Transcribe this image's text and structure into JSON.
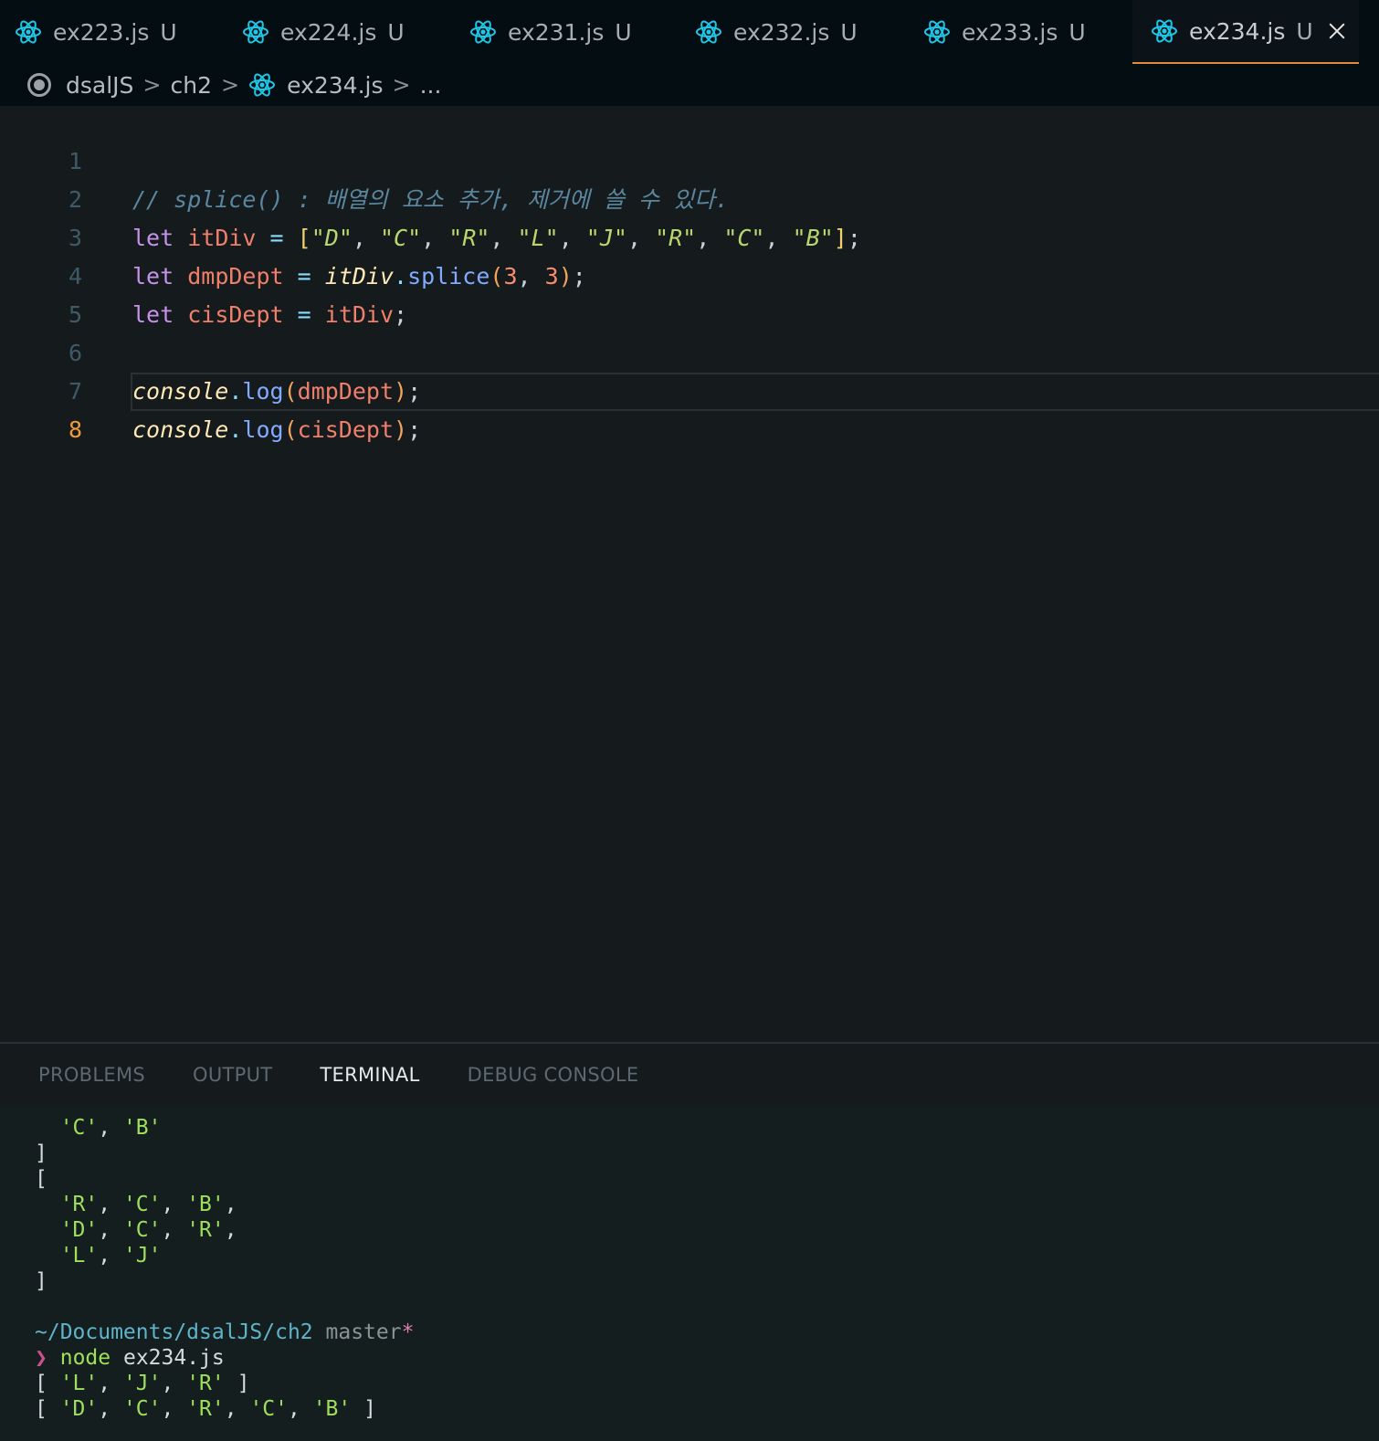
{
  "tabs": [
    {
      "label": "ex223.js",
      "status": "U"
    },
    {
      "label": "ex224.js",
      "status": "U"
    },
    {
      "label": "ex231.js",
      "status": "U"
    },
    {
      "label": "ex232.js",
      "status": "U"
    },
    {
      "label": "ex233.js",
      "status": "U"
    },
    {
      "label": "ex234.js",
      "status": "U",
      "active": true
    }
  ],
  "breadcrumb": {
    "root": "dsalJS",
    "folder": "ch2",
    "file": "ex234.js",
    "more": "...",
    "separator": ">"
  },
  "editor": {
    "current_line": 8,
    "line_numbers": [
      "1",
      "2",
      "3",
      "4",
      "5",
      "6",
      "7",
      "8"
    ],
    "lines": {
      "l1": {
        "comment": "// splice() : 배열의 요소 추가, 제거에 쓸 수 있다."
      },
      "l2": {
        "kw": "let",
        "var": "itDiv",
        "op": "=",
        "open": "[",
        "items": [
          "\"D\"",
          "\"C\"",
          "\"R\"",
          "\"L\"",
          "\"J\"",
          "\"R\"",
          "\"C\"",
          "\"B\""
        ],
        "close": "]",
        "end": ";"
      },
      "l3": {
        "kw": "let",
        "var": "dmpDept",
        "op": "=",
        "obj": "itDiv",
        "dot": ".",
        "fn": "splice",
        "lp": "(",
        "a1": "3",
        "comma": ",",
        "a2": "3",
        "rp": ")",
        "end": ";"
      },
      "l4": {
        "kw": "let",
        "var": "cisDept",
        "op": "=",
        "val": "itDiv",
        "end": ";"
      },
      "l6": {
        "obj": "console",
        "dot": ".",
        "fn": "log",
        "lp": "(",
        "arg": "dmpDept",
        "rp": ")",
        "end": ";"
      },
      "l7": {
        "obj": "console",
        "dot": ".",
        "fn": "log",
        "lp": "(",
        "arg": "cisDept",
        "rp": ")",
        "end": ";"
      }
    }
  },
  "panel": {
    "tabs": [
      "PROBLEMS",
      "OUTPUT",
      "TERMINAL",
      "DEBUG CONSOLE"
    ],
    "active_tab": "TERMINAL"
  },
  "terminal": {
    "t1": {
      "a": "'C'",
      "sep": ", ",
      "b": "'B'"
    },
    "t2": "]",
    "t3": "[",
    "t4": {
      "a": "'R'",
      "b": "'C'",
      "c": "'B'",
      "sep": ", ",
      "end": ","
    },
    "t5": {
      "a": "'D'",
      "b": "'C'",
      "c": "'R'",
      "sep": ", ",
      "end": ","
    },
    "t6": {
      "a": "'L'",
      "b": "'J'",
      "sep": ", "
    },
    "t7": "]",
    "prompt_path": "~/Documents/dsalJS/ch2",
    "prompt_branch": "master",
    "prompt_dirty": "*",
    "prompt_symbol": "❯",
    "command": "node",
    "command_arg": "ex234.js",
    "out1": {
      "open": "[ ",
      "a": "'L'",
      "b": "'J'",
      "c": "'R'",
      "sep": ", ",
      "close": " ]"
    },
    "out2": {
      "open": "[ ",
      "a": "'D'",
      "b": "'C'",
      "c": "'R'",
      "d": "'C'",
      "e": "'B'",
      "sep": ", ",
      "close": " ]"
    }
  },
  "icons": {
    "tab_file_icon": "react-icon",
    "breadcrumb_root_icon": "target-icon",
    "close_icon": "close-icon"
  },
  "colors": {
    "accent_active_tab": "#e28b3a",
    "react_icon": "#1ec8e8"
  }
}
